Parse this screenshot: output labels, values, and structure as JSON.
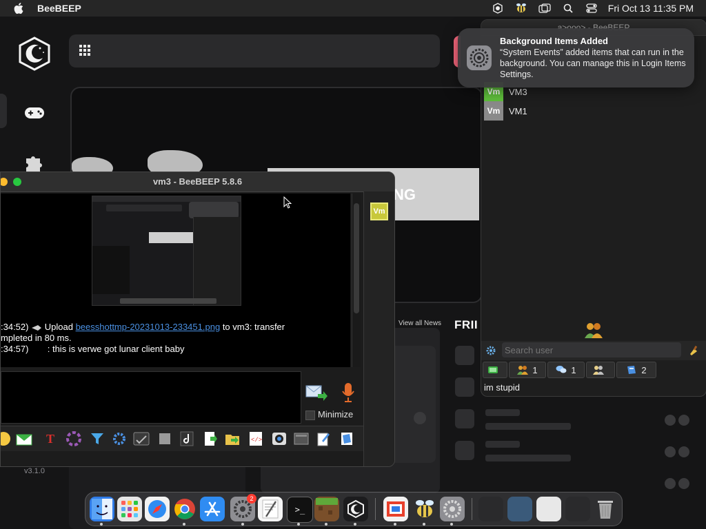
{
  "menubar": {
    "app_name": "BeeBEEP",
    "clock": "Fri Oct 13  11:35 PM",
    "icons": [
      "apple-icon",
      "lunar-icon",
      "beebeep-icon",
      "window-icon",
      "search-icon",
      "control-center-icon"
    ]
  },
  "lunar": {
    "loading_banner": "NG",
    "view_all": "View all News",
    "friends_title": "FRII",
    "version": "v3.1.0"
  },
  "notification": {
    "title": "Background Items Added",
    "body": "“System Events” added items that can run in the background. You can manage this in Login Items Settings."
  },
  "userlist": {
    "title": "a>ooo> - BeeBEEP",
    "users": [
      {
        "avatar": "Vm",
        "name": "VM3",
        "color": "#5fbf3c"
      },
      {
        "avatar": "Vm",
        "name": "VM1",
        "color": "#8a8a8a"
      }
    ],
    "search_placeholder": "Search user",
    "filters": [
      {
        "icon": "group-icon",
        "count": "1"
      },
      {
        "icon": "chat-icon",
        "count": "1"
      },
      {
        "icon": "users-icon",
        "count": ""
      },
      {
        "icon": "file-icon",
        "count": "2"
      }
    ],
    "status_text": "im stupid"
  },
  "chat": {
    "title": "vm3 - BeeBEEP 5.8.6",
    "vm_badge": "Vm",
    "messages": [
      {
        "time": ":34:52)",
        "prefix": "Upload",
        "link": "beesshottmp-20231013-233451.png",
        "suffix": "to vm3: transfer"
      },
      {
        "text": "mpleted in 80 ms."
      },
      {
        "time": ":34:57)",
        "text": ": this is verwe got lunar client baby"
      }
    ],
    "minimize_label": "Minimize"
  },
  "dock": {
    "apps": [
      "finder",
      "launchpad",
      "safari",
      "chrome",
      "app-store",
      "system-settings",
      "textedit",
      "terminal",
      "minecraft",
      "lunar-client",
      "screenshot-tool",
      "beebeep",
      "system-preferences",
      "recent-1",
      "recent-2",
      "recent-3",
      "recent-4",
      "trash"
    ],
    "badge_count": "2"
  }
}
